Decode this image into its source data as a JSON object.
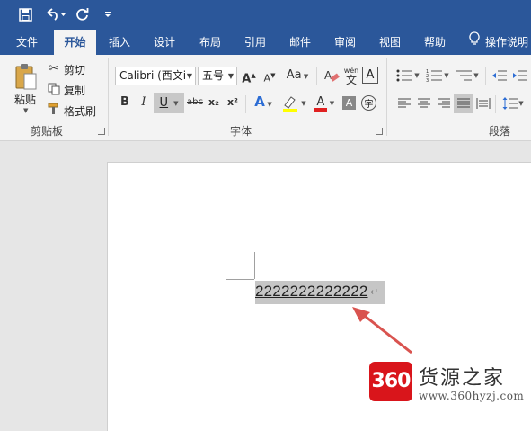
{
  "quick_access": {
    "save_icon": "save-icon",
    "undo_icon": "undo-icon",
    "redo_icon": "redo-icon",
    "customize_icon": "customize-icon"
  },
  "tabs": [
    {
      "label": "文件",
      "active": false
    },
    {
      "label": "开始",
      "active": true
    },
    {
      "label": "插入",
      "active": false
    },
    {
      "label": "设计",
      "active": false
    },
    {
      "label": "布局",
      "active": false
    },
    {
      "label": "引用",
      "active": false
    },
    {
      "label": "邮件",
      "active": false
    },
    {
      "label": "审阅",
      "active": false
    },
    {
      "label": "视图",
      "active": false
    },
    {
      "label": "帮助",
      "active": false
    }
  ],
  "tell_me": {
    "label": "操作说明"
  },
  "clipboard": {
    "paste_label": "粘贴",
    "cut_label": "剪切",
    "copy_label": "复制",
    "format_painter_label": "格式刷",
    "group_label": "剪贴板"
  },
  "font": {
    "font_name": "Calibri (西文i",
    "font_size": "五号",
    "grow_label": "A",
    "shrink_label": "A",
    "case_label": "Aa",
    "bold": "B",
    "italic": "I",
    "underline": "U",
    "strikethrough": "abc",
    "subscript": "x₂",
    "superscript": "x²",
    "char_border": "A",
    "phonetic_label": "wén",
    "enclose_label": "字",
    "group_label": "字体"
  },
  "paragraph": {
    "group_label": "段落"
  },
  "document": {
    "text": "2222222222222",
    "paragraph_mark": "↵"
  },
  "watermark": {
    "logo_text": "360",
    "title": "货源之家",
    "url": "www.360hyzj.com"
  },
  "colors": {
    "title_bar": "#2b579a",
    "ribbon": "#f3f3f3",
    "highlight_yellow": "#ffff00",
    "font_red": "#e02020",
    "arrow_red": "#d9534f"
  }
}
